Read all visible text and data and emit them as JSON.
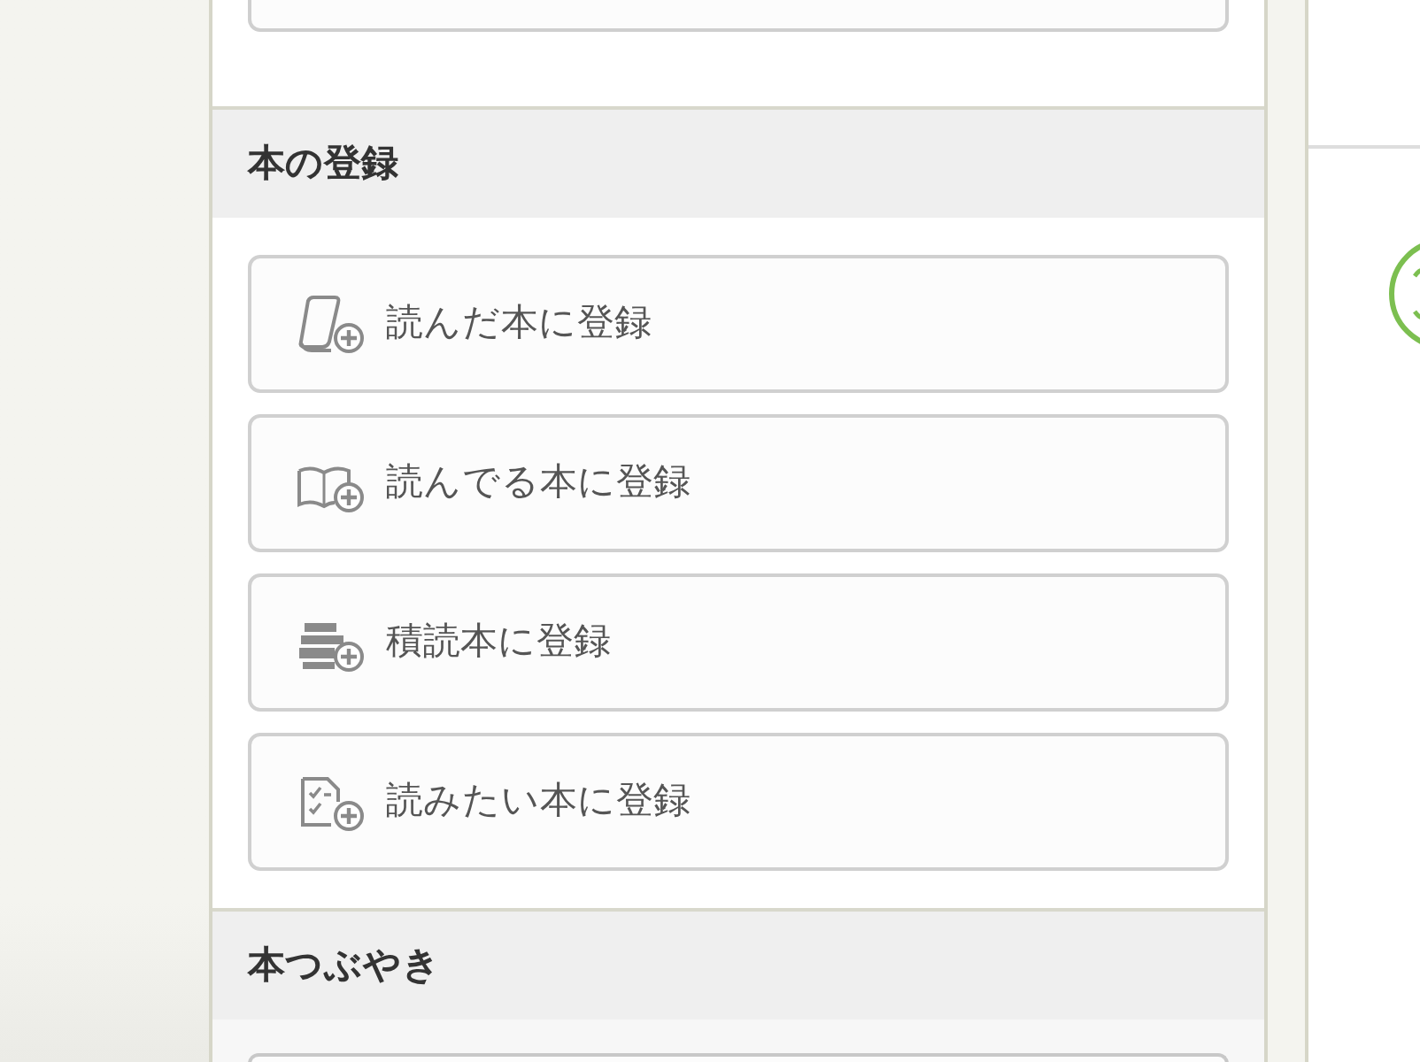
{
  "sections": [
    {
      "title": "本の登録",
      "buttons": [
        {
          "label": "読んだ本に登録",
          "kind": "read"
        },
        {
          "label": "読んでる本に登録",
          "kind": "reading"
        },
        {
          "label": "積読本に登録",
          "kind": "stacked"
        },
        {
          "label": "読みたい本に登録",
          "kind": "wish"
        }
      ]
    },
    {
      "title": "本つぶやき"
    }
  ]
}
